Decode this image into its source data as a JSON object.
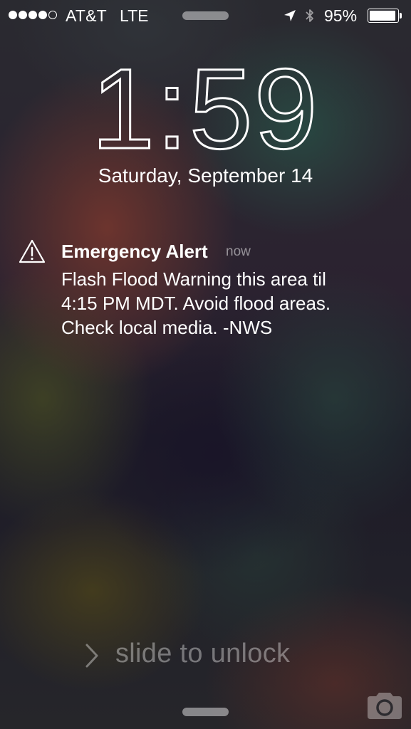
{
  "status_bar": {
    "signal_bars_filled": 4,
    "signal_bars_total": 5,
    "carrier": "AT&T",
    "network": "LTE",
    "location_icon": "location-arrow-icon",
    "bluetooth_icon": "bluetooth-icon",
    "battery_percent_text": "95%",
    "battery_level": 0.95
  },
  "lock_screen": {
    "time": "1:59",
    "date": "Saturday, September 14"
  },
  "notification": {
    "icon": "warning-triangle-icon",
    "title": "Emergency Alert",
    "time": "now",
    "body_lines": [
      "Flash Flood Warning this area til",
      "4:15 PM MDT. Avoid flood areas.",
      "Check local media. -NWS"
    ]
  },
  "unlock": {
    "label": "slide to unlock",
    "icon": "chevron-right-icon"
  },
  "camera": {
    "icon": "camera-icon"
  }
}
